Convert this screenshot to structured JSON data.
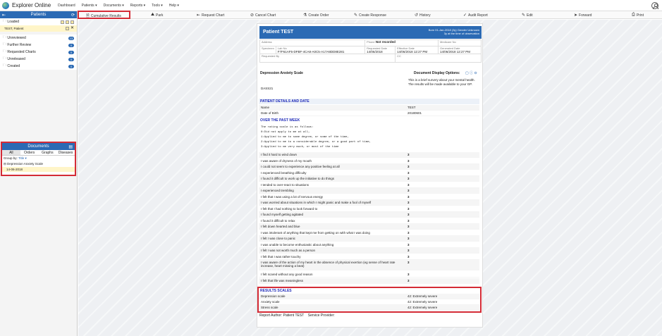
{
  "app": {
    "name": "Explorer Online"
  },
  "menu": [
    "Dashboard",
    "Patients ▾",
    "Documents ▾",
    "Reports ▾",
    "Tools ▾",
    "Help ▾"
  ],
  "sidebar": {
    "title": "Patients",
    "loaded_label": "Loaded",
    "selected_patient": "TEST, Patient",
    "items": [
      {
        "label": "Unreviewed",
        "count": "13"
      },
      {
        "label": "Further Review",
        "count": "0"
      },
      {
        "label": "Requested Charts",
        "count": "0"
      },
      {
        "label": "Unreleased",
        "count": "0"
      },
      {
        "label": "Created",
        "count": "0"
      }
    ]
  },
  "documents": {
    "title": "Documents",
    "tabs": [
      "All",
      "Orders",
      "Graphs",
      "Diseases"
    ],
    "group_by_label": "Group by:",
    "group_by_value": "Title ▾",
    "doc_title": "Depression Anxiety Scale",
    "doc_date": "14-06-2018"
  },
  "toolbar": [
    "Cumulative Results",
    "Park",
    "Request Chart",
    "Cancel Chart",
    "Create Order",
    "Create Response",
    "History",
    "Audit Report",
    "Edit",
    "Forward",
    "Print"
  ],
  "document": {
    "patient_name": "Patient TEST",
    "dob_line": "Born 01-Jan-2018 (3y) Gender Unknown",
    "age_line": "3y at the time of observation",
    "address_label": "Address",
    "phone_label": "Phone",
    "phone_value": "Not recorded",
    "medicare_label": "Medicare No",
    "specimen_label": "Specimen",
    "lab_no_label": "Lab No",
    "lab_no": "F7F61AF5-DFBF-4CA8-A0C5-A17A8DD8E281",
    "requested_date_label": "Requested Date",
    "requested_date": "14/06/2018",
    "effective_date_label": "Effective Date",
    "effective_date": "14/06/2018 12:27 PM",
    "generated_date_label": "Generated Date",
    "generated_date": "14/06/2018 12:27 PM",
    "requested_by_label": "Requested By",
    "cc_label": "CC",
    "test_name": "Depression Anxiety Scale",
    "display_options": "Document Display Options:",
    "code": "DASS21",
    "description": "This is a brief survery about your mental health. The results will be made available to your GP.",
    "section_details": "PATIENT DETAILS AND DATE",
    "name_label": "Name",
    "name_value": "TEST",
    "dob_label": "Date of Birth",
    "dob_value": "20180601",
    "section_week": "OVER THE PAST WEEK",
    "scale_text": "The rating scale is as follows:\n0:Did not apply to me at all,\n1:Applied to me to some degree, or some of the time,\n2:Applied to me to a considerable degree, or a good part of time,\n3:Applied to me very much, or most of the time",
    "questions": [
      {
        "q": "I find it hard to wind down",
        "a": "3"
      },
      {
        "q": "I was aware of dryness of my mouth",
        "a": "3"
      },
      {
        "q": "I could not seem to experience any positive feeling at all",
        "a": "3"
      },
      {
        "q": "I experienced breathing difficulty",
        "a": "3"
      },
      {
        "q": "I found it difficult to work up the initiative to do things",
        "a": "3"
      },
      {
        "q": "I tended to over-react to situations",
        "a": "3"
      },
      {
        "q": "I experienced trembling",
        "a": "3"
      },
      {
        "q": "I felt that I was using a lot of nervous energy",
        "a": "3"
      },
      {
        "q": "I was worried about situations in which I might panic and make a fool of myself",
        "a": "3"
      },
      {
        "q": "I felt that I had nothing to look forward to",
        "a": "3"
      },
      {
        "q": "I found myself getting agitated",
        "a": "3"
      },
      {
        "q": "I found it difficult to relax",
        "a": "3"
      },
      {
        "q": "I felt down hearted and blue",
        "a": "3"
      },
      {
        "q": "I was intolerant of anything that kept me from getting on with what I was doing",
        "a": "3"
      },
      {
        "q": "I felt I was close to panic",
        "a": "3"
      },
      {
        "q": "I was unable to become enthusiastic about anything",
        "a": "3"
      },
      {
        "q": "I felt I was not worth much as a person",
        "a": "3"
      },
      {
        "q": "I felt that I was rather touchy",
        "a": "3"
      },
      {
        "q": "I was aware of the action of my heart in the absence of physical exertion (eg sense of heart rate increase, heart missing a beat)",
        "a": "3"
      },
      {
        "q": "I felt scared without any good reason",
        "a": "3"
      },
      {
        "q": "I felt that life was meaningless",
        "a": "3"
      }
    ],
    "section_results": "RESULTS SCALES",
    "results": [
      {
        "label": "Depression scale",
        "value": "42: Extremely severe"
      },
      {
        "label": "Anxiety scale",
        "value": "42: Extremely severe"
      },
      {
        "label": "Stress scale",
        "value": "42: Extremely severe"
      }
    ],
    "report_author": "Report Author: Patient TEST",
    "service_provider": "Service Provider:"
  }
}
